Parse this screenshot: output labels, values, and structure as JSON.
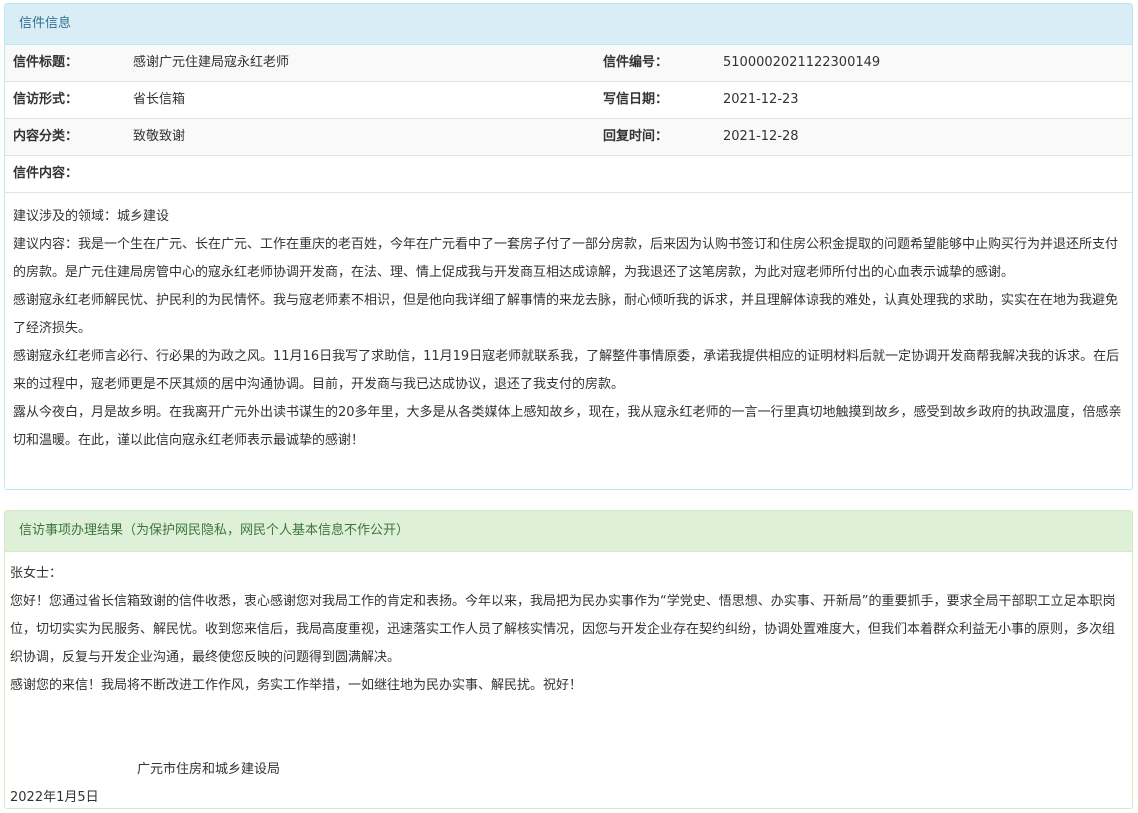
{
  "letter": {
    "header": "信件信息",
    "fields": {
      "title_label": "信件标题：",
      "title_value": "感谢广元住建局寇永红老师",
      "number_label": "信件编号：",
      "number_value": "5100002021122300149",
      "form_label": "信访形式：",
      "form_value": "省长信箱",
      "date_label": "写信日期：",
      "date_value": "2021-12-23",
      "category_label": "内容分类：",
      "category_value": "致敬致谢",
      "reply_time_label": "回复时间：",
      "reply_time_value": "2021-12-28",
      "content_label": "信件内容："
    },
    "paragraphs": [
      "建议涉及的领域：城乡建设",
      "建议内容：我是一个生在广元、长在广元、工作在重庆的老百姓，今年在广元看中了一套房子付了一部分房款，后来因为认购书签订和住房公积金提取的问题希望能够中止购买行为并退还所支付的房款。是广元住建局房管中心的寇永红老师协调开发商，在法、理、情上促成我与开发商互相达成谅解，为我退还了这笔房款，为此对寇老师所付出的心血表示诚挚的感谢。",
      "感谢寇永红老师解民忧、护民利的为民情怀。我与寇老师素不相识，但是他向我详细了解事情的来龙去脉，耐心倾听我的诉求，并且理解体谅我的难处，认真处理我的求助，实实在在地为我避免了经济损失。",
      "感谢寇永红老师言必行、行必果的为政之风。11月16日我写了求助信，11月19日寇老师就联系我，了解整件事情原委，承诺我提供相应的证明材料后就一定协调开发商帮我解决我的诉求。在后来的过程中，寇老师更是不厌其烦的居中沟通协调。目前，开发商与我已达成协议，退还了我支付的房款。",
      "露从今夜白，月是故乡明。在我离开广元外出读书谋生的20多年里，大多是从各类媒体上感知故乡，现在，我从寇永红老师的一言一行里真切地触摸到故乡，感受到故乡政府的执政温度，倍感亲切和温暖。在此，谨以此信向寇永红老师表示最诚挚的感谢！"
    ]
  },
  "reply": {
    "header": "信访事项办理结果（为保护网民隐私，网民个人基本信息不作公开）",
    "greeting": "张女士：",
    "paragraphs": [
      "您好！您通过省长信箱致谢的信件收悉，衷心感谢您对我局工作的肯定和表扬。今年以来，我局把为民办实事作为“学党史、悟思想、办实事、开新局”的重要抓手，要求全局干部职工立足本职岗位，切切实实为民服务、解民忧。收到您来信后，我局高度重视，迅速落实工作人员了解核实情况，因您与开发企业存在契约纠纷，协调处置难度大，但我们本着群众利益无小事的原则，多次组织协调，反复与开发企业沟通，最终使您反映的问题得到圆满解决。",
      "感谢您的来信！我局将不断改进工作作风，务实工作举措，一如继往地为民办实事、解民扰。祝好！"
    ],
    "signature": "广元市住房和城乡建设局",
    "date": "2022年1月5日"
  }
}
